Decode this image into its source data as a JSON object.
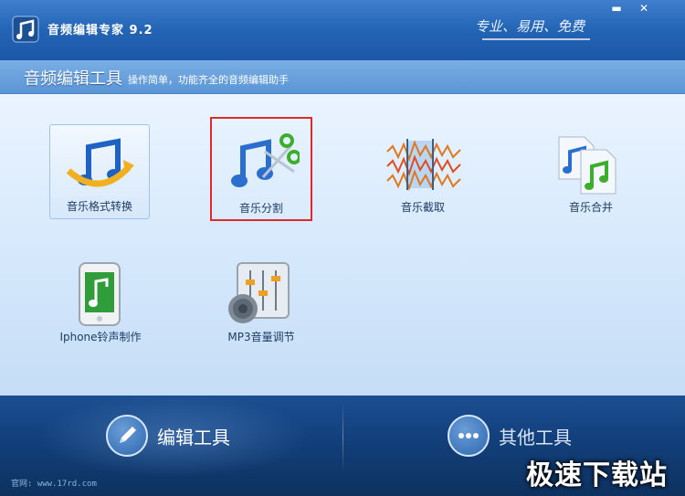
{
  "window": {
    "title": "音频编辑专家 9.2",
    "slogan": "专业、易用、免费",
    "controls": {
      "minimize": "▬",
      "close": "✕"
    }
  },
  "header": {
    "section_title": "音频编辑工具",
    "section_desc": "操作简单，功能齐全的音频编辑助手"
  },
  "tools": [
    {
      "label": "音乐格式转换",
      "icon": "music-convert-icon",
      "state": "hover"
    },
    {
      "label": "音乐分割",
      "icon": "music-split-icon",
      "state": "highlighted"
    },
    {
      "label": "音乐截取",
      "icon": "waveform-trim-icon",
      "state": "normal"
    },
    {
      "label": "音乐合并",
      "icon": "music-merge-icon",
      "state": "normal"
    },
    {
      "label": "Iphone铃声制作",
      "icon": "iphone-ringtone-icon",
      "state": "normal"
    },
    {
      "label": "MP3音量调节",
      "icon": "volume-mixer-icon",
      "state": "normal"
    }
  ],
  "bottom_tabs": [
    {
      "label": "编辑工具",
      "icon": "pencil-icon",
      "active": true
    },
    {
      "label": "其他工具",
      "icon": "more-dots-icon",
      "active": false
    }
  ],
  "status": {
    "site": "官网: www.17rd.com"
  },
  "watermark": "极速下载站",
  "colors": {
    "highlight_border": "#e02a2a",
    "title_bar": "#2464b5"
  }
}
